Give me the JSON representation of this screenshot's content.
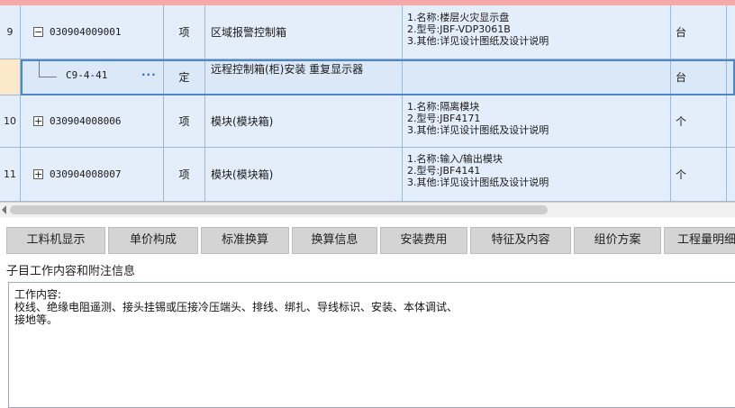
{
  "grid": {
    "top_partial_text": "3.其他:详见设计图纸及设计说明",
    "rows": [
      {
        "no": "9",
        "code": "030904009001",
        "expander": "−",
        "type": "项",
        "name": "区域报警控制箱",
        "features": [
          "1.名称:楼层火灾显示盘",
          "2.型号:JBF-VDP3061B",
          "3.其他:详见设计图纸及设计说明"
        ],
        "unit": "台"
      },
      {
        "no": "",
        "code": "C9-4-41",
        "dots": "···",
        "type": "定",
        "name": "远程控制箱(柜)安装 重复显示器",
        "features": [],
        "unit": "台"
      },
      {
        "no": "10",
        "code": "030904008006",
        "expander": "+",
        "type": "项",
        "name": "模块(模块箱)",
        "features": [
          "1.名称:隔离模块",
          "2.型号:JBF4171",
          "3.其他:详见设计图纸及设计说明"
        ],
        "unit": "个"
      },
      {
        "no": "11",
        "code": "030904008007",
        "expander": "+",
        "type": "项",
        "name": "模块(模块箱)",
        "features": [
          "1.名称:输入/输出模块",
          "2.型号:JBF4141",
          "3.其他:详见设计图纸及设计说明"
        ],
        "unit": "个"
      }
    ]
  },
  "tabs": [
    "工料机显示",
    "单价构成",
    "标准换算",
    "换算信息",
    "安装费用",
    "特征及内容",
    "组价方案",
    "工程量明细"
  ],
  "section_title": "子目工作内容和附注信息",
  "content_lines": [
    "工作内容:",
    "校线、绝缘电阻遥测、接头挂锡或压接冷压端头、排线、绑扎、导线标识、安装、本体调试、",
    "接地等。"
  ]
}
